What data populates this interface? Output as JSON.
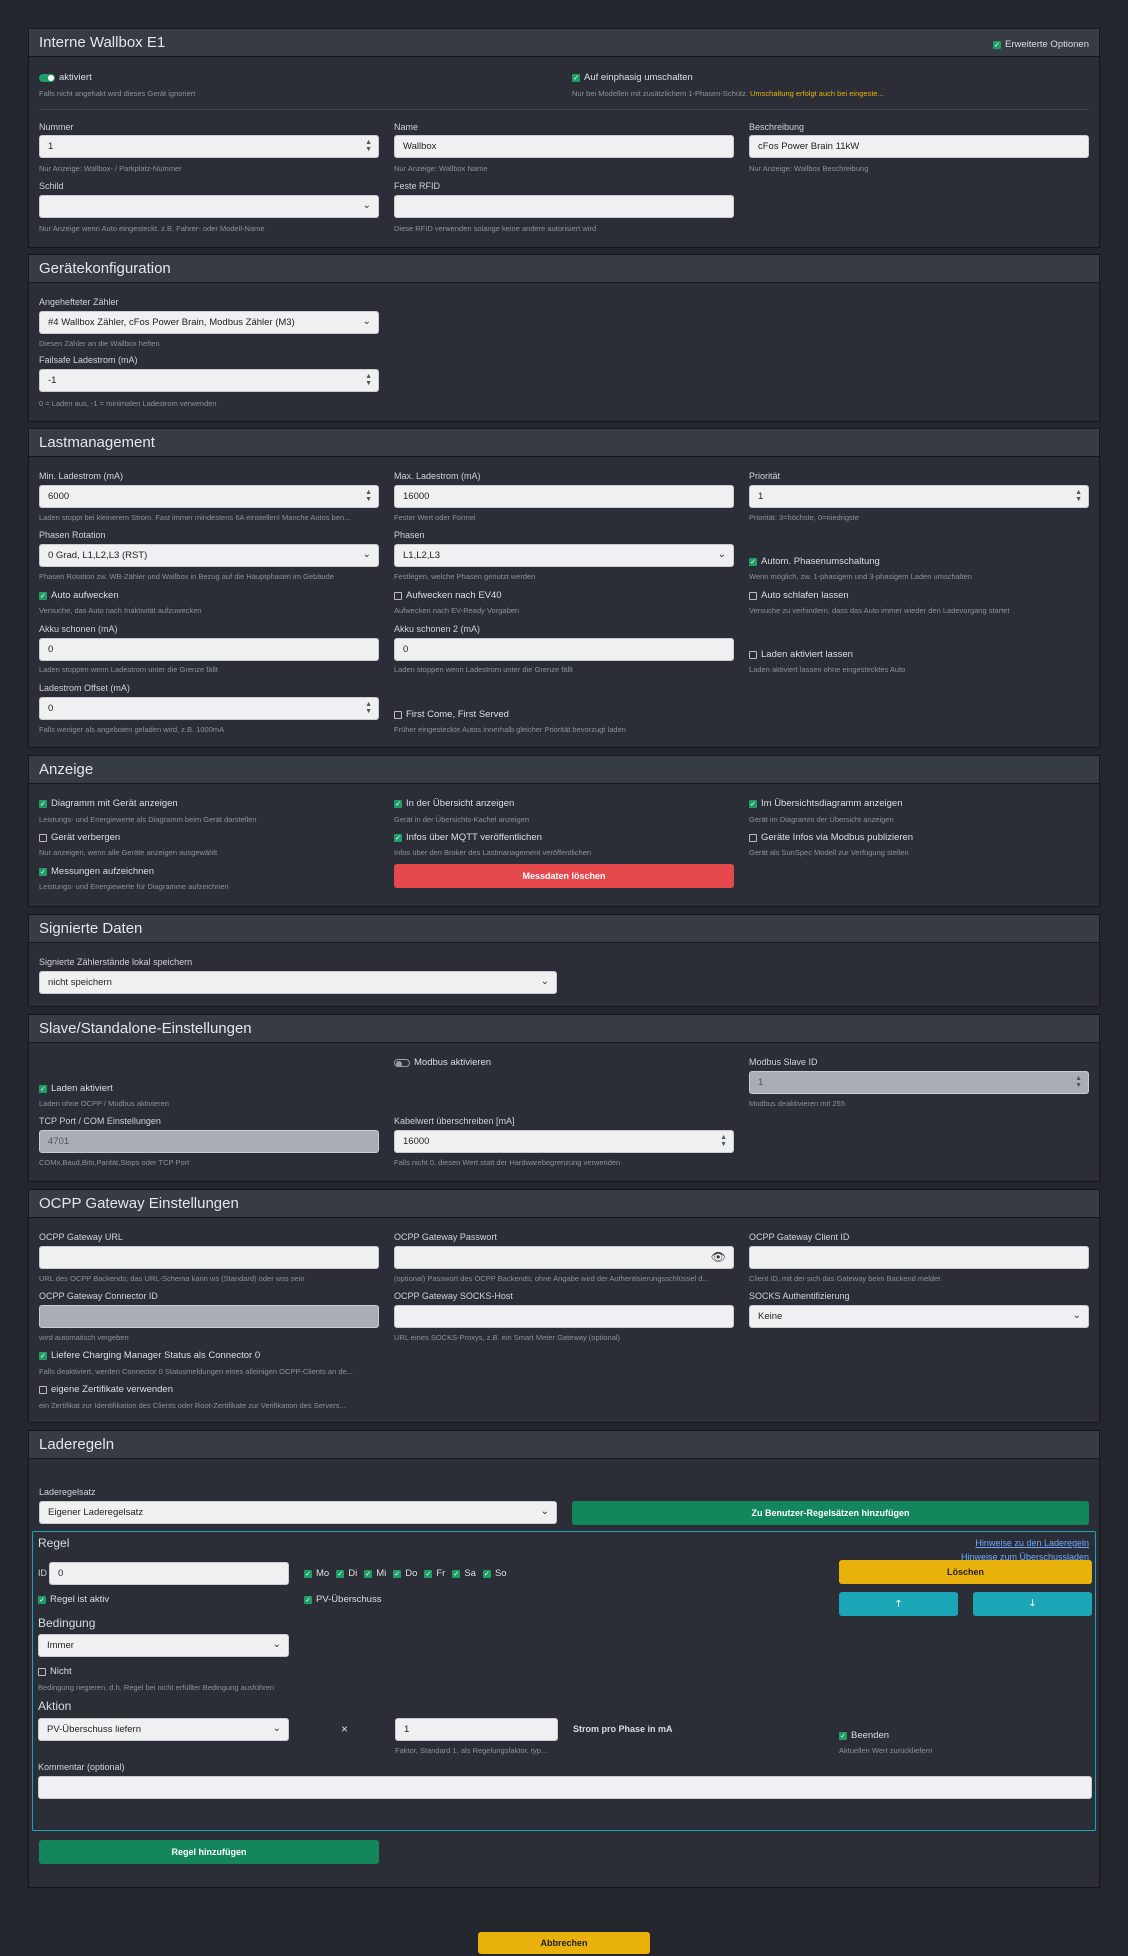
{
  "wallbox": {
    "title": "Interne Wallbox E1",
    "erweitert": "Erweiterte Optionen",
    "aktiviert": "aktiviert",
    "aktiviert_hint": "Falls nicht angehakt wird dieses Gerät ignoriert",
    "einphasig": "Auf einphasig umschalten",
    "einphasig_hint": "Nur bei Modellen mit zusätzlichem 1-Phasen-Schütz.",
    "einphasig_warn": "Umschaltung erfolgt auch bei eingeste...",
    "nummer_label": "Nummer",
    "nummer_value": "1",
    "nummer_hint": "Nur Anzeige: Wallbox- / Parkplatz-Nummer",
    "name_label": "Name",
    "name_value": "Wallbox",
    "name_hint": "Nur Anzeige: Wallbox Name",
    "beschr_label": "Beschreibung",
    "beschr_value": "cFos Power Brain 11kW",
    "beschr_hint": "Nur Anzeige: Wallbox Beschreibung",
    "schild_label": "Schild",
    "schild_value": "",
    "schild_hint": "Nur Anzeige wenn Auto eingesteckt. z.B. Fahrer- oder Modell-Name",
    "rfid_label": "Feste RFID",
    "rfid_value": "",
    "rfid_hint": "Diese RFID verwenden solange keine andere autorisiert wird"
  },
  "geraet": {
    "title": "Gerätekonfiguration",
    "zaehler_label": "Angehefteter Zähler",
    "zaehler_value": "#4 Wallbox Zähler, cFos Power Brain, Modbus Zähler (M3)",
    "zaehler_hint": "Diesen Zähler an die Wallbox heften",
    "failsafe_label": "Failsafe Ladestrom (mA)",
    "failsafe_value": "-1",
    "failsafe_hint": "0 = Laden aus, -1 = minimalen Ladestrom verwenden"
  },
  "last": {
    "title": "Lastmanagement",
    "min_label": "Min. Ladestrom (mA)",
    "min_value": "6000",
    "min_hint": "Laden stoppt bei kleinerem Strom. Fast immer mindestens 6A einstellen! Manche Autos ben...",
    "max_label": "Max. Ladestrom (mA)",
    "max_value": "16000",
    "max_hint": "Fester Wert oder Formel",
    "prio_label": "Priorität",
    "prio_value": "1",
    "prio_hint": "Priorität: 3=höchste, 0=niedrigste",
    "rot_label": "Phasen Rotation",
    "rot_value": "0 Grad, L1,L2,L3 (RST)",
    "rot_hint": "Phasen Rotation zw. WB-Zähler und Wallbox in Bezug auf die Hauptphasen im Gebäude",
    "phasen_label": "Phasen",
    "phasen_value": "L1,L2,L3",
    "phasen_hint": "Festlegen, welche Phasen genutzt werden",
    "auto_ph": "Autom. Phasenumschaltung",
    "auto_ph_hint": "Wenn möglich, zw. 1-phasigem und 3-phasigem Laden umschalten",
    "aufwecken": "Auto aufwecken",
    "aufwecken_hint": "Versuche, das Auto nach Inaktivität aufzuwecken",
    "ev40": "Aufwecken nach EV40",
    "ev40_hint": "Aufwecken nach EV-Ready Vorgaben",
    "schlafen": "Auto schlafen lassen",
    "schlafen_hint": "Versuche zu verhindern, dass das Auto immer wieder den Ladevorgang startet",
    "akku1_label": "Akku schonen (mA)",
    "akku1_value": "0",
    "akku1_hint": "Laden stoppen wenn Ladestrom unter die Grenze fällt",
    "akku2_label": "Akku schonen 2 (mA)",
    "akku2_value": "0",
    "akku2_hint": "Laden stoppen wenn Ladestrom unter die Grenze fällt",
    "laden_akt": "Laden aktiviert lassen",
    "laden_akt_hint": "Laden aktiviert lassen ohne eingestecktes Auto",
    "offset_label": "Ladestrom Offset (mA)",
    "offset_value": "0",
    "offset_hint": "Falls weniger als angeboten geladen wird, z.B. 1000mA",
    "fcfs": "First Come, First Served",
    "fcfs_hint": "Früher eingesteckte Autos innerhalb gleicher Priorität bevorzugt laden"
  },
  "anzeige": {
    "title": "Anzeige",
    "diag": "Diagramm mit Gerät anzeigen",
    "diag_hint": "Leistungs- und Energiewerte als Diagramm beim Gerät darstellen",
    "uebersicht": "In der Übersicht anzeigen",
    "uebersicht_hint": "Gerät in der Übersichts-Kachel anzeigen",
    "ue_diag": "Im Übersichtsdiagramm anzeigen",
    "ue_diag_hint": "Gerät im Diagramm der Übersicht anzeigen",
    "verbergen": "Gerät verbergen",
    "verbergen_hint": "Nur anzeigen, wenn alle Geräte anzeigen ausgewählt",
    "mqtt": "Infos über MQTT veröffentlichen",
    "mqtt_hint": "Infos über den Broker des Lastmanagement veröffentlichen",
    "modbus": "Geräte Infos via Modbus publizieren",
    "modbus_hint": "Gerät als SunSpec Modell zur Verfügung stellen",
    "mess": "Messungen aufzeichnen",
    "mess_hint": "Leistungs- und Energiewerte für Diagramme aufzeichnen",
    "loeschen": "Messdaten löschen"
  },
  "signiert": {
    "title": "Signierte Daten",
    "label": "Signierte Zählerstände lokal speichern",
    "value": "nicht speichern"
  },
  "slave": {
    "title": "Slave/Standalone-Einstellungen",
    "modbus_akt": "Modbus aktivieren",
    "slave_label": "Modbus Slave ID",
    "slave_value": "1",
    "slave_hint": "Modbus deaktivieren mit 255",
    "laden": "Laden aktiviert",
    "laden_hint": "Laden ohne OCPP / Modbus aktivieren",
    "tcp_label": "TCP Port / COM Einstellungen",
    "tcp_value": "4701",
    "tcp_hint": "COMx,Baud,Bits,Parität,Stops oder TCP Port",
    "kabel_label": "Kabelwert überschreiben [mA]",
    "kabel_value": "16000",
    "kabel_hint": "Falls nicht 0, diesen Wert statt der Hardwarebegrenzung verwenden"
  },
  "ocpp": {
    "title": "OCPP Gateway Einstellungen",
    "url_label": "OCPP Gateway URL",
    "url_value": "",
    "url_hint": "URL des OCPP Backends; das URL-Schema kann ws (Standard) oder wss sein",
    "pw_label": "OCPP Gateway Passwort",
    "pw_value": "",
    "pw_hint": "(optional) Passwort des OCPP Backends; ohne Angabe wird der Authentisierungsschlüssel d...",
    "cid_label": "OCPP Gateway Client ID",
    "cid_value": "",
    "cid_hint": "Client ID, mit der sich das Gateway beim Backend meldet",
    "conn_label": "OCPP Gateway Connector ID",
    "conn_value": "",
    "conn_hint": "wird automatisch vergeben",
    "socks_label": "OCPP Gateway SOCKS-Host",
    "socks_value": "",
    "socks_hint": "URL eines SOCKS-Proxys, z.B. ein Smart Meter Gateway (optional)",
    "sauth_label": "SOCKS Authentifizierung",
    "sauth_value": "Keine",
    "cm": "Liefere Charging Manager Status als Connector 0",
    "cm_hint": "Falls deaktiviert, werden Connector 0 Statusmeldungen eines alleinigen OCPP-Clients an de...",
    "zert": "eigene Zertifikate verwenden",
    "zert_hint": "ein Zertifikat zur Identifikation des Clients oder Root-Zertifikate zur Verifikation des Servers..."
  },
  "lade": {
    "title": "Laderegeln",
    "satz_label": "Laderegelsatz",
    "satz_value": "Eigener Laderegelsatz",
    "add_user": "Zu Benutzer-Regelsätzen hinzufügen",
    "regel": "Regel",
    "hinweis1": "Hinweise zu den Laderegeln",
    "hinweis2": "Hinweise zum Überschussladen",
    "id_label": "ID",
    "id_value": "0",
    "days": [
      "Mo",
      "Di",
      "Mi",
      "Do",
      "Fr",
      "Sa",
      "So"
    ],
    "loeschen": "Löschen",
    "up": "🡑",
    "down": "🡓",
    "aktiv": "Regel ist aktiv",
    "pv": "PV-Überschuss",
    "bedingung": "Bedingung",
    "bed_value": "Immer",
    "nicht": "Nicht",
    "nicht_hint": "Bedingung negieren, d.h. Regel bei nicht erfüllter Bedingung ausführen",
    "aktion": "Aktion",
    "akt_value": "PV-Überschuss liefern",
    "times": "×",
    "faktor_value": "1",
    "faktor_hint": "Faktor, Standard 1, als Regelungsfaktor, typ...",
    "strom": "Strom pro Phase in mA",
    "beenden": "Beenden",
    "beenden_hint": "Aktuellen Wert zurückliefern",
    "kommentar": "Kommentar (optional)",
    "kommentar_value": "",
    "add_regel": "Regel hinzufügen"
  },
  "footer": {
    "abbrechen": "Abbrechen"
  }
}
